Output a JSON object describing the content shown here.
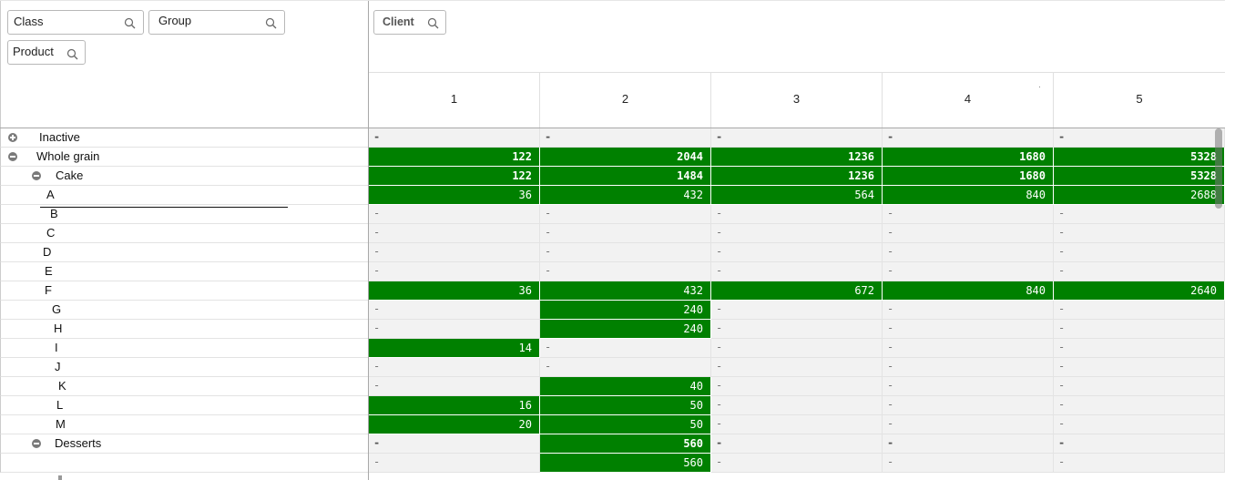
{
  "dimension_filters": [
    {
      "label": "Class",
      "icon": "search-icon"
    },
    {
      "label": "Group",
      "icon": "search-icon"
    },
    {
      "label": "Product",
      "icon": "search-icon"
    }
  ],
  "column_filter": {
    "label": "Client",
    "icon": "search-icon"
  },
  "columns": [
    "1",
    "2",
    "3",
    "4",
    "5"
  ],
  "colors": {
    "highlight": "#008000",
    "empty_cell": "#f2f2f2"
  },
  "rows": [
    {
      "label": "Inactive",
      "level": 0,
      "toggle": "expand",
      "bold": true,
      "values": [
        "-",
        "-",
        "-",
        "-",
        "-"
      ]
    },
    {
      "label": "Whole grain",
      "level": 0,
      "toggle": "collapse",
      "bold": true,
      "values": [
        "122",
        "2044",
        "1236",
        "1680",
        "5328"
      ]
    },
    {
      "label": "Cake",
      "level": 1,
      "toggle": "collapse",
      "bold": true,
      "values": [
        "122",
        "1484",
        "1236",
        "1680",
        "5328"
      ]
    },
    {
      "label": "A",
      "level": 2,
      "bold": false,
      "values": [
        "36",
        "432",
        "564",
        "840",
        "2688"
      ]
    },
    {
      "label": "B",
      "level": 2,
      "bold": false,
      "values": [
        "-",
        "-",
        "-",
        "-",
        "-"
      ]
    },
    {
      "label": "C",
      "level": 2,
      "bold": false,
      "values": [
        "-",
        "-",
        "-",
        "-",
        "-"
      ]
    },
    {
      "label": "D",
      "level": 2,
      "bold": false,
      "values": [
        "-",
        "-",
        "-",
        "-",
        "-"
      ]
    },
    {
      "label": "E",
      "level": 2,
      "bold": false,
      "values": [
        "-",
        "-",
        "-",
        "-",
        "-"
      ]
    },
    {
      "label": "F",
      "level": 2,
      "bold": false,
      "values": [
        "36",
        "432",
        "672",
        "840",
        "2640"
      ]
    },
    {
      "label": "G",
      "level": 2,
      "bold": false,
      "values": [
        "-",
        "240",
        "-",
        "-",
        "-"
      ]
    },
    {
      "label": "H",
      "level": 2,
      "bold": false,
      "values": [
        "-",
        "240",
        "-",
        "-",
        "-"
      ]
    },
    {
      "label": "I",
      "level": 2,
      "bold": false,
      "values": [
        "14",
        "-",
        "-",
        "-",
        "-"
      ]
    },
    {
      "label": "J",
      "level": 2,
      "bold": false,
      "values": [
        "-",
        "-",
        "-",
        "-",
        "-"
      ]
    },
    {
      "label": "K",
      "level": 2,
      "bold": false,
      "values": [
        "-",
        "40",
        "-",
        "-",
        "-"
      ]
    },
    {
      "label": "L",
      "level": 2,
      "bold": false,
      "values": [
        "16",
        "50",
        "-",
        "-",
        "-"
      ]
    },
    {
      "label": "M",
      "level": 2,
      "bold": false,
      "values": [
        "20",
        "50",
        "-",
        "-",
        "-"
      ]
    },
    {
      "label": "Desserts",
      "level": 1,
      "toggle": "collapse",
      "bold": true,
      "values": [
        "-",
        "560",
        "-",
        "-",
        "-"
      ]
    },
    {
      "label": "",
      "level": 2,
      "bold": false,
      "values": [
        "-",
        "560",
        "-",
        "-",
        "-"
      ]
    }
  ]
}
